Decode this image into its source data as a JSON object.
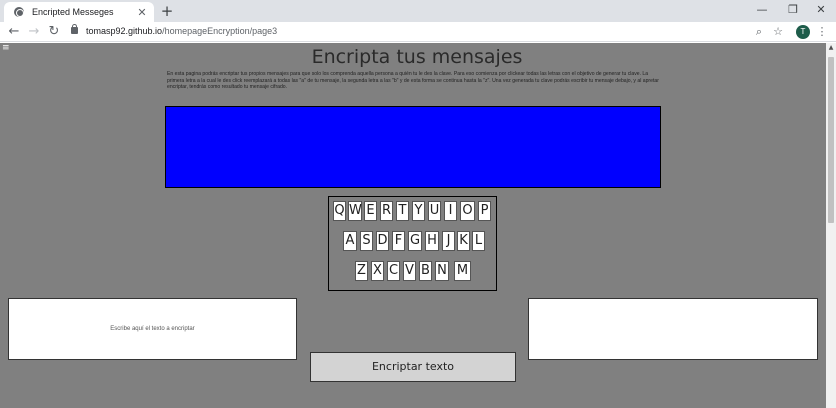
{
  "browser": {
    "tab_title": "Encripted Messeges",
    "tab_close": "✕",
    "new_tab": "+",
    "url_host": "tomasp92.github.io",
    "url_path": "/homepageEncryption/page3",
    "avatar_letter": "T",
    "window_controls": {
      "minimize": "—",
      "restore": "❐",
      "close": "✕"
    },
    "nav": {
      "back": "←",
      "forward": "→",
      "reload": "↻"
    },
    "icons": {
      "zoom": "⌕",
      "star": "☆",
      "menu": "⋮"
    }
  },
  "page": {
    "menu_icon": "≡",
    "title": "Encripta tus mensajes",
    "intro": "En esta pagina podrás encriptar tus propios mensajes para que solo los comprenda aquella persona a quién tu le des la clave. Para eso comienza por clickear todas las letras con el objetivo de generar tu clave. La primera letra a la cual le des click reemplazará a todas las \"a\" de tu mensaje, la segunda letra a las \"b\" y de esta forma se continua hasta la \"z\". Una vez generada tu clave podrás escribir tu mensaje debajo, y al apretar encriptar, tendrás como resultado tu mensaje cifrado.",
    "cipher_color": "#0000ff",
    "keyboard": {
      "row1": [
        "Q",
        "W",
        "E",
        "R",
        "T",
        "Y",
        "U",
        "I",
        "O",
        "P"
      ],
      "row2": [
        "A",
        "S",
        "D",
        "F",
        "G",
        "H",
        "J",
        "K",
        "L"
      ],
      "row3": [
        "Z",
        "X",
        "C",
        "V",
        "B",
        "N",
        "M"
      ]
    },
    "input_placeholder": "Escribe aquí el texto a encriptar",
    "output_text": "",
    "encrypt_label": "Encriptar texto"
  }
}
